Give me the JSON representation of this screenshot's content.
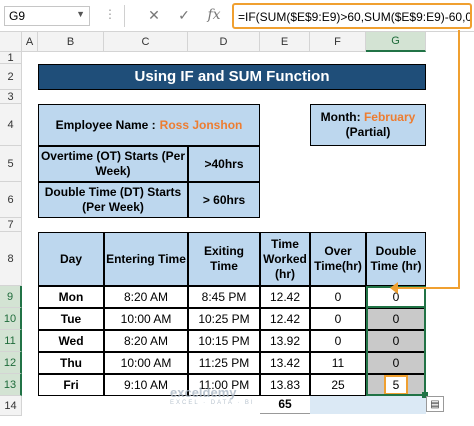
{
  "formula_bar": {
    "name_box": "G9",
    "cancel_icon": "✕",
    "confirm_icon": "✓",
    "fx_icon": "fx",
    "formula": "=IF(SUM($E$9:E9)>60,SUM($E$9:E9)-60,0)"
  },
  "columns": [
    "A",
    "B",
    "C",
    "D",
    "E",
    "F",
    "G"
  ],
  "rows": [
    "1",
    "2",
    "3",
    "4",
    "5",
    "6",
    "7",
    "8",
    "9",
    "10",
    "11",
    "12",
    "13",
    "14"
  ],
  "title": "Using IF and SUM Function",
  "employee": {
    "label": "Employee Name : ",
    "name": "Ross Jonshon"
  },
  "month": {
    "label": "Month: ",
    "value": "February",
    "note": "(Partial)"
  },
  "rules": [
    {
      "label": "Overtime (OT) Starts (Per Week)",
      "value": ">40hrs"
    },
    {
      "label": "Double Time (DT) Starts (Per Week)",
      "value": "> 60hrs"
    }
  ],
  "table": {
    "headers": [
      "Day",
      "Entering Time",
      "Exiting Time",
      "Time Worked (hr)",
      "Over Time(hr)",
      "Double Time (hr)"
    ],
    "rows": [
      [
        "Mon",
        "8:20 AM",
        "8:45 PM",
        "12.42",
        "0",
        "0"
      ],
      [
        "Tue",
        "10:00 AM",
        "10:25 PM",
        "12.42",
        "0",
        "0"
      ],
      [
        "Wed",
        "8:20 AM",
        "10:15 PM",
        "13.92",
        "0",
        "0"
      ],
      [
        "Thu",
        "10:00 AM",
        "11:25 PM",
        "13.42",
        "11",
        "0"
      ],
      [
        "Fri",
        "9:10 AM",
        "11:00 PM",
        "13.83",
        "25",
        "5"
      ]
    ],
    "total": "65"
  },
  "watermark": {
    "name": "exceldemy",
    "tag": "EXCEL · DATA · BI"
  },
  "colors": {
    "banner": "#1f4e79",
    "cell_fill": "#bdd7ee",
    "highlight": "#f0a030",
    "accent": "#ed7d31",
    "selection": "#217346"
  }
}
